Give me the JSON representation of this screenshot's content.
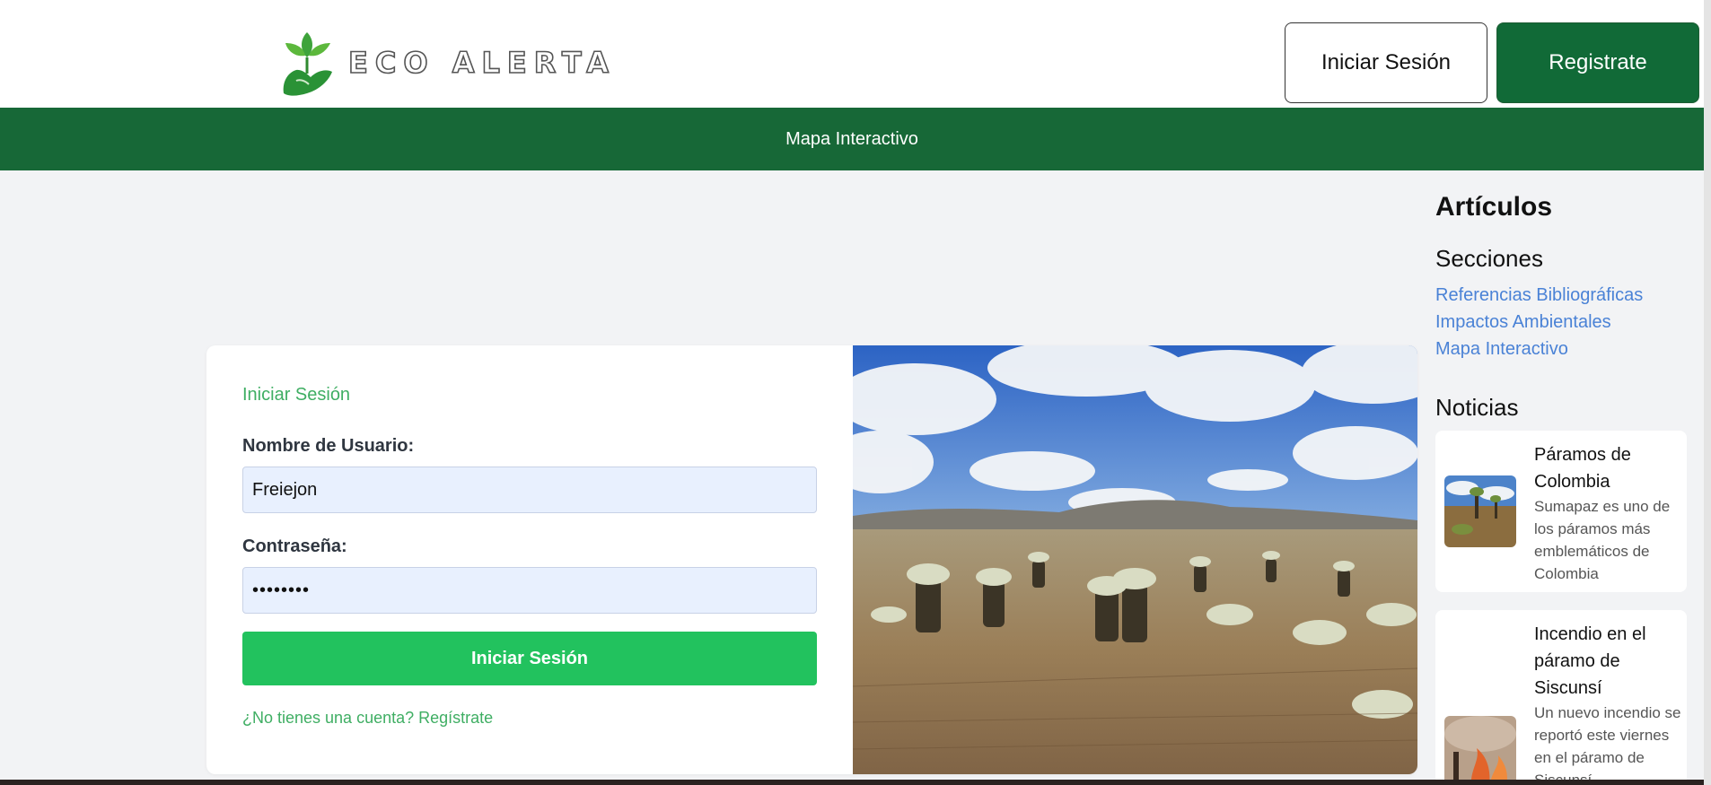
{
  "header": {
    "logo_text": "ECO ALERTA",
    "login_label": "Iniciar Sesión",
    "register_label": "Registrate"
  },
  "nav": {
    "items": [
      "Mapa Interactivo"
    ]
  },
  "login": {
    "title": "Iniciar Sesión",
    "username_label": "Nombre de Usuario:",
    "username_value": "Freiejon",
    "password_label": "Contraseña:",
    "password_value": "••••••••",
    "submit_label": "Iniciar Sesión",
    "signup_link": "¿No tienes una cuenta? Regístrate"
  },
  "sidebar": {
    "title": "Artículos",
    "sections_heading": "Secciones",
    "sections": [
      "Referencias Bibliográficas",
      "Impactos Ambientales",
      "Mapa Interactivo"
    ],
    "news_heading": "Noticias",
    "news": [
      {
        "title": "Páramos de Colombia",
        "description": "Sumapaz es uno de los páramos más emblemáticos de Colombia"
      },
      {
        "title": "Incendio en el páramo de Siscunsí",
        "description": "Un nuevo incendio se reportó este viernes en el páramo de Siscunsí"
      }
    ]
  },
  "colors": {
    "brand_green": "#176837",
    "button_green": "#22c25e",
    "link_green": "#3fae63",
    "link_blue": "#4a82d6"
  }
}
